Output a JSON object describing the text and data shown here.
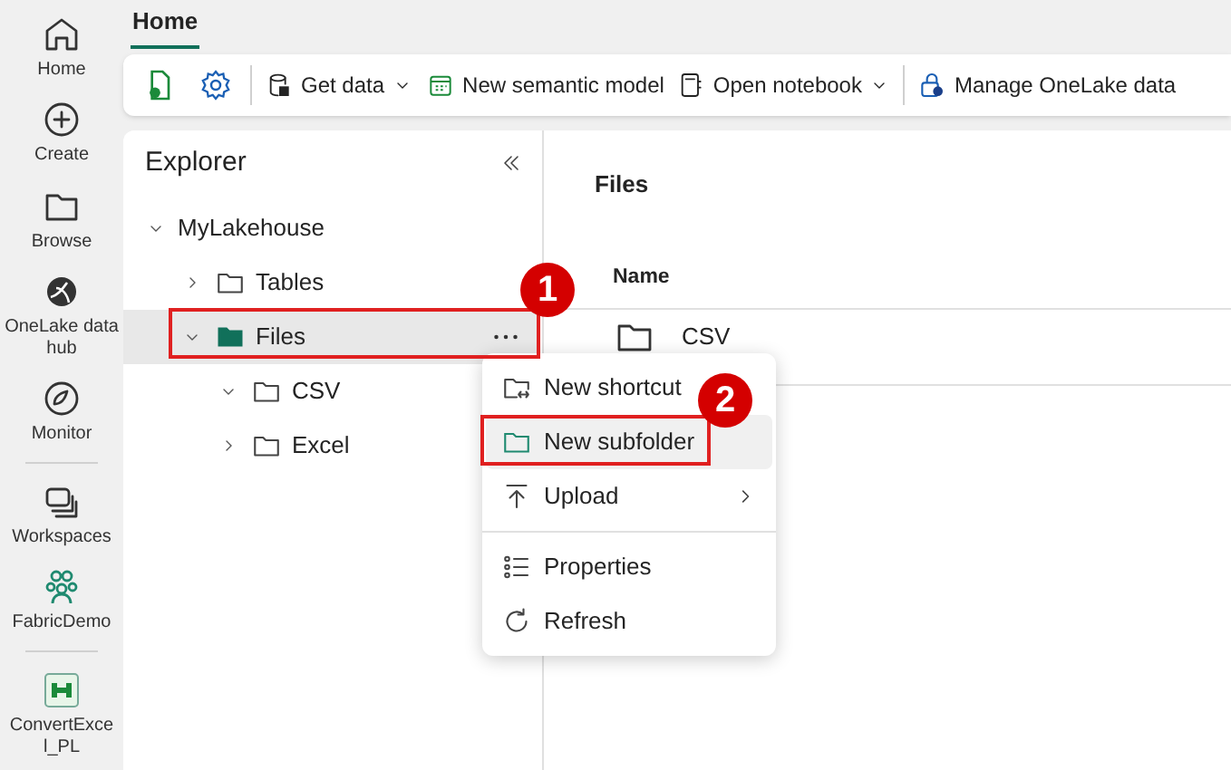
{
  "rail": [
    {
      "label": "Home"
    },
    {
      "label": "Create"
    },
    {
      "label": "Browse"
    },
    {
      "label": "OneLake data hub"
    },
    {
      "label": "Monitor",
      "divider_after": true
    },
    {
      "label": "Workspaces"
    },
    {
      "label": "FabricDemo",
      "divider_after": true
    },
    {
      "label": "ConvertExce l_PL"
    }
  ],
  "tabs": [
    {
      "label": "Home",
      "selected": true
    }
  ],
  "toolbar": [
    {
      "kind": "icon"
    },
    {
      "kind": "icon",
      "divider_after": true
    },
    {
      "kind": "button",
      "label": "Get data",
      "dropdown": true
    },
    {
      "kind": "button",
      "label": "New semantic model"
    },
    {
      "kind": "button",
      "label": "Open notebook",
      "dropdown": true,
      "divider_after": true
    },
    {
      "kind": "button",
      "label": "Manage OneLake data"
    }
  ],
  "explorer": {
    "title": "Explorer",
    "tree": [
      {
        "label": "MyLakehouse",
        "expanded": true,
        "selected": false,
        "children": [
          {
            "label": "Tables",
            "expanded": false,
            "selected": false
          },
          {
            "label": "Files",
            "expanded": true,
            "selected": true,
            "annotation": "1",
            "children": [
              {
                "label": "CSV",
                "expanded": true,
                "selected": false
              },
              {
                "label": "Excel",
                "expanded": false,
                "selected": false
              }
            ]
          }
        ]
      }
    ]
  },
  "content": {
    "title": "Files",
    "columns": [
      "Name"
    ],
    "rows": [
      {
        "name": "CSV"
      }
    ]
  },
  "context_menu": {
    "groups": [
      [
        {
          "label": "New shortcut",
          "highlighted": false
        },
        {
          "label": "New subfolder",
          "highlighted": true,
          "annotation": "2"
        },
        {
          "label": "Upload",
          "submenu": true,
          "highlighted": false
        }
      ],
      [
        {
          "label": "Properties",
          "highlighted": false
        },
        {
          "label": "Refresh",
          "highlighted": false
        }
      ]
    ]
  }
}
